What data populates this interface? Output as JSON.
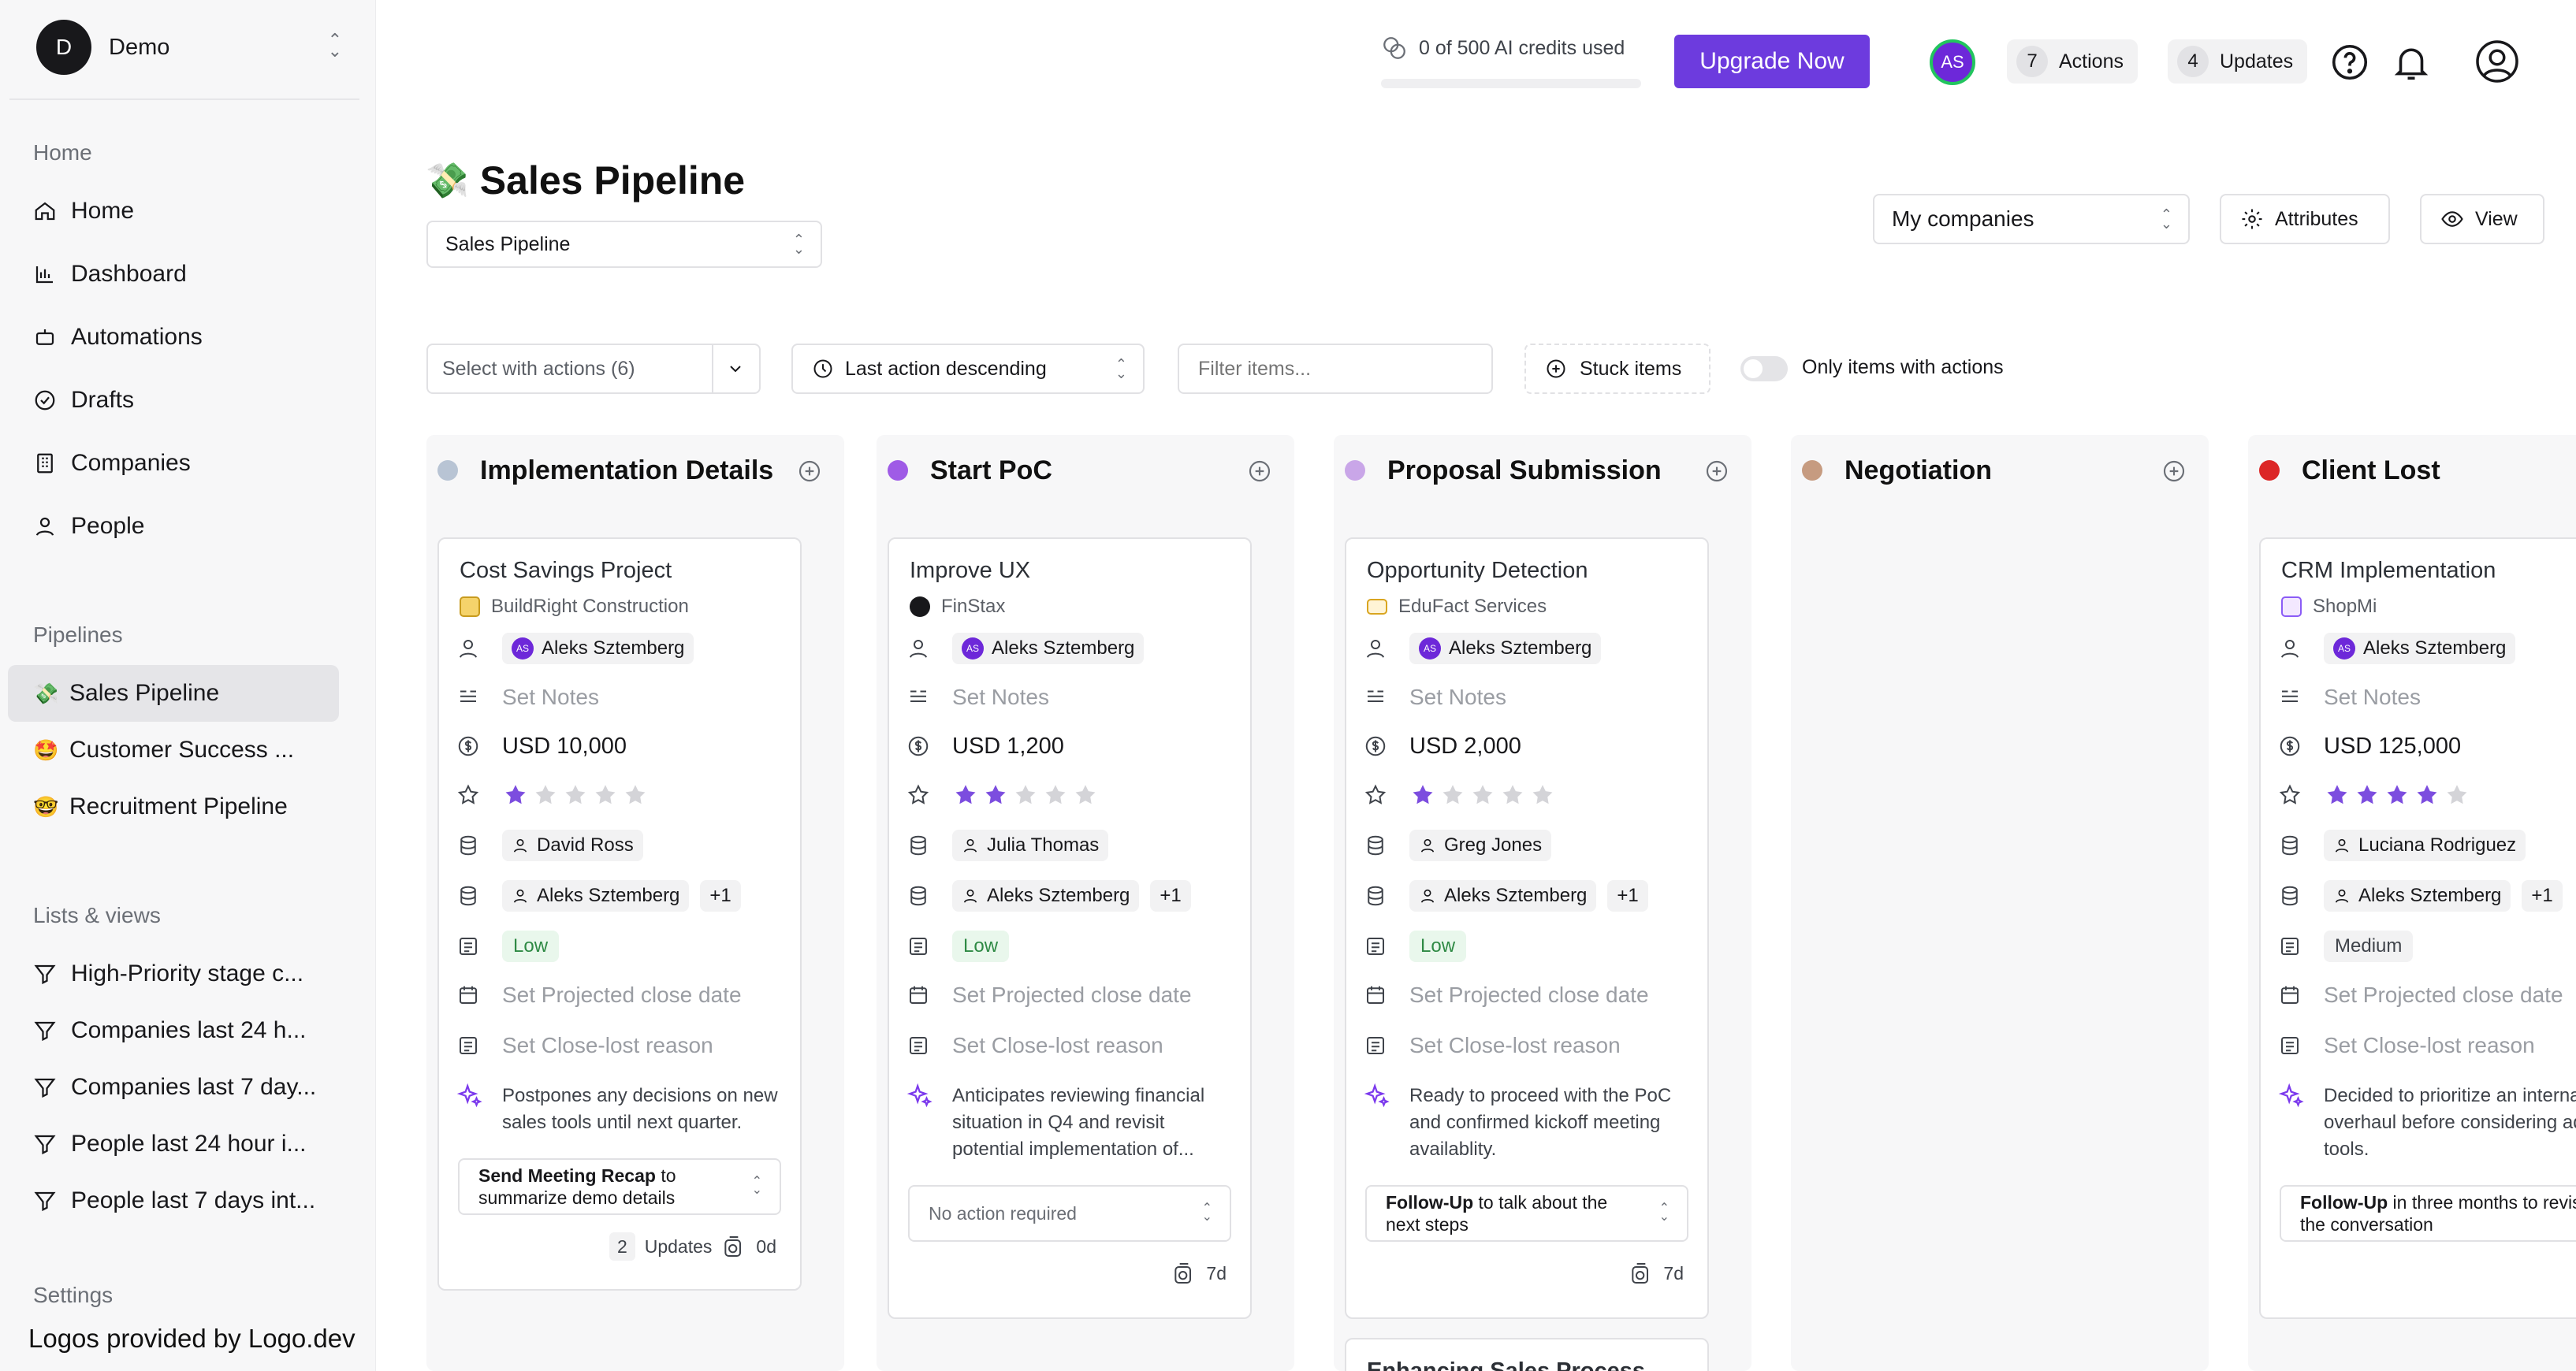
{
  "workspace": {
    "initial": "D",
    "name": "Demo"
  },
  "sidebar": {
    "home_section": "Home",
    "nav": [
      {
        "label": "Home",
        "icon": "home-icon"
      },
      {
        "label": "Dashboard",
        "icon": "chart-icon"
      },
      {
        "label": "Automations",
        "icon": "robot-icon"
      },
      {
        "label": "Drafts",
        "icon": "check-circle-icon"
      },
      {
        "label": "Companies",
        "icon": "building-icon"
      },
      {
        "label": "People",
        "icon": "person-icon"
      }
    ],
    "pipelines_section": "Pipelines",
    "pipelines": [
      {
        "emoji": "💸",
        "label": "Sales Pipeline",
        "active": true
      },
      {
        "emoji": "🤩",
        "label": "Customer Success ..."
      },
      {
        "emoji": "🤓",
        "label": "Recruitment Pipeline"
      }
    ],
    "lists_section": "Lists & views",
    "lists": [
      {
        "label": "High-Priority stage c..."
      },
      {
        "label": "Companies last 24 h..."
      },
      {
        "label": "Companies last 7 day..."
      },
      {
        "label": "People last 24 hour i..."
      },
      {
        "label": "People last 7 days int..."
      }
    ],
    "settings_section": "Settings",
    "footer_note": "Logos provided by Logo.dev"
  },
  "topbar": {
    "credits": "0 of 500 AI credits used",
    "upgrade": "Upgrade Now",
    "avatar": "AS",
    "actions_count": "7",
    "actions_label": "Actions",
    "updates_count": "4",
    "updates_label": "Updates"
  },
  "header": {
    "emoji": "💸",
    "title": "Sales Pipeline",
    "pipeline_select": "Sales Pipeline",
    "companies_select": "My companies",
    "attributes": "Attributes",
    "view": "View"
  },
  "filters": {
    "select_actions": "Select with actions (6)",
    "sort": "Last action descending",
    "filter_placeholder": "Filter items...",
    "stuck": "Stuck items",
    "only_actions": "Only items with actions"
  },
  "colors": {
    "accent": "#6d3bde",
    "implementation": "#b8c4d4",
    "start_poc": "#9f5be6",
    "proposal": "#c9a6e8",
    "negotiation": "#c69b80",
    "client_lost": "#dc2626"
  },
  "columns": [
    {
      "title": "Implementation Details",
      "cards": [
        {
          "title": "Cost Savings Project",
          "company": "BuildRight Construction",
          "owner": "Aleks Sztemberg",
          "notes": "Set Notes",
          "value": "USD 10,000",
          "rating": 1,
          "contact": "David Ross",
          "contact2": "Aleks Sztemberg",
          "extra": "+1",
          "priority": "Low",
          "close_date": "Set Projected close date",
          "close_reason": "Set Close-lost reason",
          "ai_summary": "Postpones any decisions on new sales tools until next quarter.",
          "action_bold": "Send Meeting Recap",
          "action_rest": " to summarize demo details",
          "updates_count": "2",
          "updates_label": "Updates",
          "age": "0d"
        }
      ]
    },
    {
      "title": "Start PoC",
      "cards": [
        {
          "title": "Improve UX",
          "company": "FinStax",
          "owner": "Aleks Sztemberg",
          "notes": "Set Notes",
          "value": "USD 1,200",
          "rating": 2,
          "contact": "Julia Thomas",
          "contact2": "Aleks Sztemberg",
          "extra": "+1",
          "priority": "Low",
          "close_date": "Set Projected close date",
          "close_reason": "Set Close-lost reason",
          "ai_summary": "Anticipates reviewing financial situation in Q4 and revisit potential implementation of...",
          "action_none": "No action required",
          "age": "7d"
        }
      ]
    },
    {
      "title": "Proposal Submission",
      "cards": [
        {
          "title": "Opportunity Detection",
          "company": "EduFact Services",
          "owner": "Aleks Sztemberg",
          "notes": "Set Notes",
          "value": "USD 2,000",
          "rating": 1,
          "contact": "Greg Jones",
          "contact2": "Aleks Sztemberg",
          "extra": "+1",
          "priority": "Low",
          "close_date": "Set Projected close date",
          "close_reason": "Set Close-lost reason",
          "ai_summary": "Ready to proceed with the PoC and confirmed kickoff meeting availablity.",
          "action_bold": "Follow-Up",
          "action_rest": " to talk about the next steps",
          "age": "7d"
        },
        {
          "title": "Enhancing Sales Process"
        }
      ]
    },
    {
      "title": "Negotiation",
      "cards": []
    },
    {
      "title": "Client Lost",
      "cards": [
        {
          "title": "CRM Implementation",
          "company": "ShopMi",
          "owner": "Aleks Sztemberg",
          "notes": "Set Notes",
          "value": "USD 125,000",
          "rating": 4,
          "contact": "Luciana Rodriguez",
          "contact2": "Aleks Sztemberg",
          "extra": "+1",
          "priority": "Medium",
          "close_date": "Set Projected close date",
          "close_reason": "Set Close-lost reason",
          "ai_summary": "Decided to prioritize an internal CRM overhaul before considering additional tools.",
          "action_bold": "Follow-Up",
          "action_rest": " in three months to revisit the conversation"
        }
      ]
    }
  ]
}
